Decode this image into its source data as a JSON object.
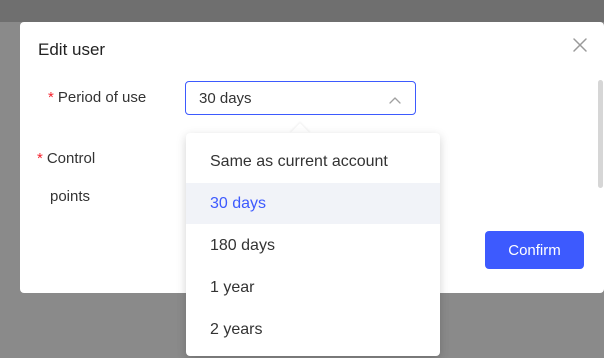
{
  "dialog": {
    "title": "Edit user",
    "close_icon": "close-icon"
  },
  "form": {
    "period_label": "Period of use",
    "period_required_mark": "*",
    "control_label_line1": "Control",
    "control_label_line2": "points",
    "control_required_mark": "*"
  },
  "select": {
    "value": "30 days",
    "chevron_icon": "chevron-up-icon"
  },
  "dropdown": {
    "options": [
      {
        "label": "Same as current account",
        "selected": false
      },
      {
        "label": "30 days",
        "selected": true
      },
      {
        "label": "180 days",
        "selected": false
      },
      {
        "label": "1 year",
        "selected": false
      },
      {
        "label": "2 years",
        "selected": false
      }
    ]
  },
  "buttons": {
    "confirm_label": "Confirm"
  },
  "colors": {
    "accent": "#3d5afe",
    "required": "#f5222d",
    "selected_option_bg": "#f1f3f8",
    "overlay": "#8a8a8a"
  }
}
